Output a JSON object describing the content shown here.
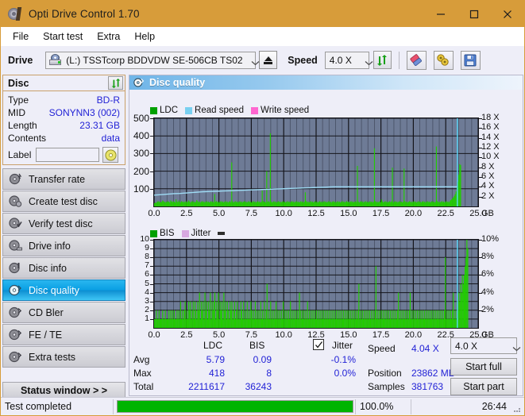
{
  "window": {
    "title": "Opti Drive Control 1.70",
    "icon": "disc-icon",
    "minimize_label": "minimize-icon",
    "maximize_label": "maximize-icon",
    "close_label": "close-icon",
    "titlebar_color": "#d79c3a"
  },
  "menu": {
    "items": [
      {
        "label": "File"
      },
      {
        "label": "Start test"
      },
      {
        "label": "Extra"
      },
      {
        "label": "Help"
      }
    ]
  },
  "toolbar": {
    "drive_label": "Drive",
    "drive_value": "(L:)  TSSTcorp BDDVDW SE-506CB TS02",
    "eject_label": "eject-icon",
    "speed_label": "Speed",
    "speed_value": "4.0 X",
    "refresh_label": "refresh-icon",
    "erase_label": "erase-icon",
    "tools_label": "tools-icon",
    "save_label": "save-icon"
  },
  "disc_panel": {
    "title": "Disc",
    "refresh_label": "refresh-icon",
    "rows": [
      {
        "key": "Type",
        "value": "BD-R"
      },
      {
        "key": "MID",
        "value": "SONYNN3 (002)"
      },
      {
        "key": "Length",
        "value": "23.31 GB"
      },
      {
        "key": "Contents",
        "value": "data"
      }
    ],
    "label_key": "Label",
    "label_value": "",
    "label_placeholder": "",
    "label_button": "disc-label-icon"
  },
  "sidebar": {
    "items": [
      {
        "label": "Transfer rate",
        "icon": "disc-transfer-icon",
        "active": false
      },
      {
        "label": "Create test disc",
        "icon": "disc-create-icon",
        "active": false
      },
      {
        "label": "Verify test disc",
        "icon": "disc-verify-icon",
        "active": false
      },
      {
        "label": "Drive info",
        "icon": "disc-drive-icon",
        "active": false
      },
      {
        "label": "Disc info",
        "icon": "disc-info-icon",
        "active": false
      },
      {
        "label": "Disc quality",
        "icon": "disc-quality-icon",
        "active": true
      },
      {
        "label": "CD Bler",
        "icon": "disc-bler-icon",
        "active": false
      },
      {
        "label": "FE / TE",
        "icon": "disc-fete-icon",
        "active": false
      },
      {
        "label": "Extra tests",
        "icon": "disc-extra-icon",
        "active": false
      }
    ],
    "status_window_label": "Status window > >"
  },
  "main": {
    "title": "Disc quality",
    "icon": "disc-quality-icon"
  },
  "stats": {
    "col_headers": [
      "LDC",
      "BIS"
    ],
    "row_headers": [
      "Avg",
      "Max",
      "Total"
    ],
    "ldc": {
      "avg": "5.79",
      "max": "418",
      "total": "2211617"
    },
    "bis": {
      "avg": "0.09",
      "max": "8",
      "total": "36243"
    },
    "jitter_label": "Jitter",
    "jitter_checked": true,
    "jitter_avg": "-0.1%",
    "jitter_max": "0.0%",
    "speed_key": "Speed",
    "speed_value": "4.04 X",
    "position_key": "Position",
    "position_value": "23862 MB",
    "samples_key": "Samples",
    "samples_value": "381763",
    "speed_select_value": "4.0 X",
    "start_full_label": "Start full",
    "start_part_label": "Start part"
  },
  "statusbar": {
    "text": "Test completed",
    "progress_pct": "100.0%",
    "progress_value": 100,
    "elapsed": "26:44",
    "progress_color": "#00b400"
  },
  "chart_data": [
    {
      "type": "line",
      "name": "disc-quality-ldc",
      "title": "",
      "legend": [
        {
          "label": "LDC",
          "color": "#00a000"
        },
        {
          "label": "Read speed",
          "color": "#79d0f0"
        },
        {
          "label": "Write speed",
          "color": "#ff66d0"
        }
      ],
      "legend_position": "top-left",
      "xlabel": "GB",
      "ylabel": "LDC",
      "y2label": "X",
      "xlim": [
        0,
        25.0
      ],
      "ylim": [
        0,
        500
      ],
      "y2lim": [
        0,
        18
      ],
      "xticks": [
        "0.0",
        "2.5",
        "5.0",
        "7.5",
        "10.0",
        "12.5",
        "15.0",
        "17.5",
        "20.0",
        "22.5",
        "25.0"
      ],
      "xtick_unit": "GB",
      "yticks": [
        100,
        200,
        300,
        400,
        500
      ],
      "y2ticks": [
        "2 X",
        "4 X",
        "6 X",
        "8 X",
        "10 X",
        "12 X",
        "14 X",
        "16 X",
        "18 X"
      ],
      "grid": true,
      "plot_bg": "#6e7b96",
      "series": [
        {
          "name": "LDC",
          "color": "#22cc00",
          "type": "bar",
          "values": [
            18,
            22,
            20,
            26,
            30,
            24,
            28,
            22,
            26,
            34,
            30,
            26,
            22,
            28,
            24,
            30,
            26,
            22,
            34,
            28,
            24,
            30,
            26,
            22,
            40,
            28,
            24,
            34,
            26,
            22,
            30,
            26,
            24,
            28,
            22,
            30,
            26,
            24,
            34,
            28,
            22,
            26,
            30,
            24,
            28,
            22,
            26,
            36,
            30,
            24,
            28,
            22,
            26,
            30,
            24,
            28,
            22,
            26,
            30,
            24,
            28,
            22,
            26,
            30,
            24,
            28,
            22,
            70,
            26,
            30,
            24,
            28,
            22,
            26,
            30,
            24,
            28,
            22,
            26,
            30,
            24,
            28,
            22,
            26,
            30,
            24,
            250,
            28,
            22,
            26,
            30,
            24,
            28,
            22,
            26,
            30,
            24,
            28,
            22,
            26,
            30,
            24,
            28,
            22,
            26,
            30,
            24,
            28,
            22,
            26,
            30,
            24,
            28,
            22,
            26,
            30,
            24,
            28,
            22,
            26,
            90,
            30,
            24,
            28,
            22,
            200,
            26,
            30,
            24,
            415,
            28,
            22,
            26,
            30,
            24,
            28,
            22,
            26,
            30,
            24,
            28,
            22,
            26,
            30,
            24,
            28,
            22,
            26,
            30,
            24,
            28,
            22,
            26,
            30,
            24,
            28,
            22,
            26,
            30,
            24,
            28,
            22,
            26,
            30,
            24,
            28,
            22,
            26,
            80,
            30,
            24,
            28,
            22,
            26,
            30,
            24,
            28,
            22,
            26,
            30,
            24,
            28,
            22,
            26,
            30,
            24,
            28,
            22,
            26,
            30,
            24,
            28,
            22,
            26,
            30,
            24,
            28,
            22,
            26,
            30,
            24,
            28,
            22,
            26,
            30,
            24,
            28,
            22,
            26,
            30,
            24,
            28,
            22,
            26,
            30,
            24,
            28,
            22,
            26,
            30,
            24,
            28,
            22,
            26,
            30,
            24,
            230,
            28,
            22,
            26,
            30,
            24,
            28,
            22,
            26,
            30,
            24,
            28,
            22,
            26,
            30,
            24,
            28,
            22,
            26,
            330,
            30,
            24,
            28,
            22,
            26,
            30,
            24,
            40,
            28,
            22,
            26,
            30,
            24,
            28,
            22,
            26,
            30,
            24,
            28,
            220,
            22,
            26,
            30,
            24,
            28,
            22,
            26,
            30,
            24,
            28,
            22,
            26,
            215,
            30,
            24,
            28,
            22,
            26,
            30,
            24,
            28,
            22,
            26,
            30,
            24,
            28,
            22,
            26,
            30,
            24,
            28,
            22,
            26,
            30,
            24,
            28,
            22,
            26,
            30,
            24,
            28,
            22,
            26,
            30,
            24,
            28,
            22,
            26,
            340,
            30,
            24,
            28,
            22,
            26,
            30,
            24,
            28,
            22,
            26,
            30,
            24,
            28,
            22,
            30,
            36,
            40,
            46,
            52,
            60,
            70,
            85,
            110,
            140,
            180,
            240,
            235,
            0,
            0,
            0,
            0,
            0,
            0,
            0,
            0,
            0,
            0,
            0,
            0,
            0,
            0,
            0,
            0,
            0,
            0,
            0
          ]
        },
        {
          "name": "Read speed",
          "color": "#9fdcf5",
          "type": "line",
          "axis": "right",
          "values": [
            2.3,
            2.35,
            2.4,
            2.45,
            2.5,
            2.55,
            2.6,
            2.62,
            2.65,
            2.7,
            2.75,
            2.8,
            2.85,
            2.9,
            2.95,
            3.0,
            3.02,
            3.05,
            3.08,
            3.1,
            3.12,
            3.15,
            3.18,
            3.2,
            3.22,
            3.25,
            3.28,
            3.3,
            3.32,
            3.35,
            3.38,
            3.4,
            3.42,
            3.45,
            3.48,
            3.5,
            3.52,
            3.55,
            3.58,
            3.6,
            3.62,
            3.65,
            3.68,
            3.7,
            3.72,
            3.75,
            3.78,
            3.8,
            3.82,
            3.85,
            3.88,
            3.9,
            3.92,
            3.95,
            3.98,
            4.0,
            4.0,
            4.0,
            4.0,
            4.0,
            4.0,
            4.0,
            4.0,
            4.0,
            4.0,
            4.0,
            4.0,
            4.0,
            4.0,
            4.0,
            4.0,
            4.0,
            4.0,
            4.0,
            4.0,
            4.0,
            4.0,
            4.0,
            4.0,
            4.0,
            4.0,
            4.0,
            4.0,
            4.0,
            4.0,
            4.0,
            4.0,
            4.0,
            4.0,
            4.0,
            4.0,
            4.0,
            4.0,
            4.0
          ]
        },
        {
          "name": "Write speed",
          "color": "#ff66d0",
          "type": "line",
          "values": []
        },
        {
          "name": "end-marker",
          "color": "#58d8f8",
          "type": "vline",
          "x": 23.4
        }
      ]
    },
    {
      "type": "bar",
      "name": "disc-quality-bis",
      "title": "",
      "legend": [
        {
          "label": "BIS",
          "color": "#00a000"
        },
        {
          "label": "Jitter",
          "color": "#d8a8e0"
        }
      ],
      "legend_position": "top-left",
      "xlabel": "GB",
      "ylabel": "BIS",
      "y2label": "%",
      "xlim": [
        0,
        25.0
      ],
      "ylim": [
        0,
        10
      ],
      "y2lim": [
        0,
        10
      ],
      "xticks": [
        "0.0",
        "2.5",
        "5.0",
        "7.5",
        "10.0",
        "12.5",
        "15.0",
        "17.5",
        "20.0",
        "22.5",
        "25.0"
      ],
      "xtick_unit": "GB",
      "yticks": [
        1,
        2,
        3,
        4,
        5,
        6,
        7,
        8,
        9,
        10
      ],
      "y2ticks": [
        "2%",
        "4%",
        "6%",
        "8%",
        "10%"
      ],
      "grid": true,
      "plot_bg": "#6e7b96",
      "series": [
        {
          "name": "BIS",
          "color": "#22cc00",
          "type": "bar",
          "values": [
            1,
            1,
            2,
            1,
            1,
            2,
            1,
            1,
            1,
            2,
            1,
            1,
            2,
            1,
            1,
            1,
            2,
            1,
            2,
            1,
            2,
            1,
            2,
            1,
            1,
            2,
            1,
            2,
            1,
            3,
            1,
            2,
            1,
            2,
            3,
            1,
            2,
            1,
            3,
            2,
            3,
            1,
            2,
            3,
            1,
            3,
            2,
            1,
            3,
            2,
            4,
            1,
            3,
            2,
            3,
            1,
            4,
            2,
            3,
            1,
            3,
            2,
            4,
            1,
            3,
            2,
            3,
            4,
            1,
            3,
            2,
            4,
            1,
            3,
            2,
            3,
            1,
            4,
            2,
            3,
            1,
            3,
            2,
            1,
            3,
            2,
            3,
            1,
            2,
            3,
            1,
            2,
            3,
            1,
            2,
            1,
            3,
            2,
            1,
            3,
            1,
            2,
            1,
            3,
            1,
            2,
            1,
            3,
            2,
            1,
            2,
            1,
            3,
            1,
            2,
            1,
            2,
            1,
            3,
            1,
            2,
            1,
            3,
            1,
            2,
            5,
            1,
            2,
            1,
            3,
            1,
            2,
            1,
            2,
            1,
            3,
            1,
            2,
            1,
            2,
            1,
            2,
            1,
            3,
            1,
            2,
            1,
            2,
            1,
            2,
            1,
            3,
            1,
            2,
            1,
            2,
            1,
            2,
            1,
            2,
            1,
            4,
            2,
            1,
            2,
            1,
            2,
            1,
            2,
            1,
            3,
            1,
            2,
            1,
            2,
            1,
            2,
            1,
            2,
            1,
            2,
            1,
            2,
            1,
            2,
            1,
            2,
            1,
            2,
            1,
            2,
            1,
            2,
            1,
            2,
            1,
            2,
            1,
            2,
            1,
            2,
            1,
            2,
            1,
            2,
            1,
            2,
            1,
            2,
            1,
            2,
            1,
            2,
            1,
            2,
            1,
            2,
            1,
            2,
            1,
            2,
            1,
            2,
            1,
            2,
            1,
            2,
            5,
            1,
            2,
            1,
            2,
            1,
            2,
            1,
            2,
            1,
            2,
            1,
            2,
            1,
            2,
            1,
            2,
            1,
            2,
            7,
            1,
            2,
            1,
            2,
            1,
            2,
            1,
            2,
            1,
            2,
            1,
            2,
            1,
            2,
            1,
            2,
            1,
            2,
            1,
            2,
            1,
            2,
            1,
            2,
            4,
            1,
            2,
            1,
            2,
            1,
            2,
            1,
            2,
            1,
            2,
            1,
            2,
            4,
            1,
            2,
            1,
            2,
            1,
            2,
            1,
            2,
            1,
            2,
            1,
            2,
            1,
            2,
            1,
            2,
            1,
            2,
            1,
            2,
            1,
            2,
            1,
            2,
            1,
            2,
            1,
            2,
            1,
            2,
            1,
            2,
            1,
            2,
            1,
            2,
            1,
            2,
            8,
            1,
            2,
            1,
            2,
            1,
            2,
            1,
            2,
            4,
            1,
            2,
            1,
            3,
            2,
            4,
            3,
            5,
            4,
            6,
            5,
            6,
            7,
            8,
            10,
            9,
            0,
            0,
            0,
            0,
            0,
            0,
            0,
            0,
            0,
            0,
            0
          ]
        },
        {
          "name": "Jitter",
          "color": "#d8a8e0",
          "type": "line",
          "values": []
        },
        {
          "name": "end-marker",
          "color": "#58d8f8",
          "type": "vline",
          "x": 23.4
        }
      ]
    }
  ]
}
